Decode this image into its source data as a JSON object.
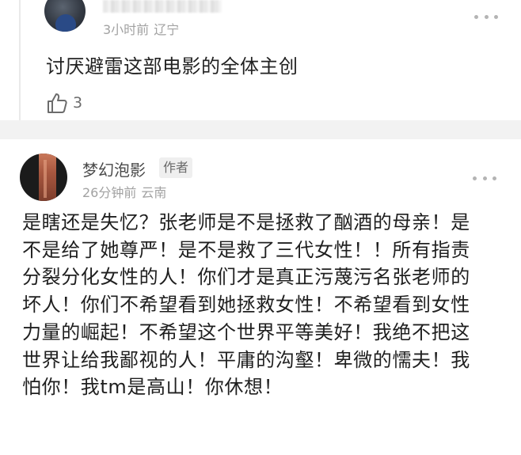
{
  "reply": {
    "time": "3小时前",
    "location": "辽宁",
    "text": "讨厌避雷这部电影的全体主创",
    "likes": "3",
    "icons": {
      "avatar": "user-avatar",
      "like": "thumbs-up-icon",
      "more": "more-dots-icon"
    }
  },
  "comment": {
    "author": "梦幻泡影",
    "badge": "作者",
    "time": "26分钟前",
    "location": "云南",
    "lines": [
      "是瞎还是失忆？张老师是不是拯救了酗酒的母亲！是",
      "不是给了她尊严！是不是救了三代女性！！所有指责",
      "分裂分化女性的人！你们才是真正污蔑污名张老师的",
      "坏人！你们不希望看到她拯救女性！不希望看到女性",
      "力量的崛起！不希望这个世界平等美好！我绝不把这",
      "世界让给我鄙视的人！平庸的沟壑！卑微的懦夫！我",
      "怕你！我tm是高山！你休想！"
    ]
  },
  "colors": {
    "meta_gray": "#a2a2a2",
    "text_dark": "#1f1f1f",
    "separator": "#f2f2f2",
    "badge_bg": "#efefef"
  }
}
